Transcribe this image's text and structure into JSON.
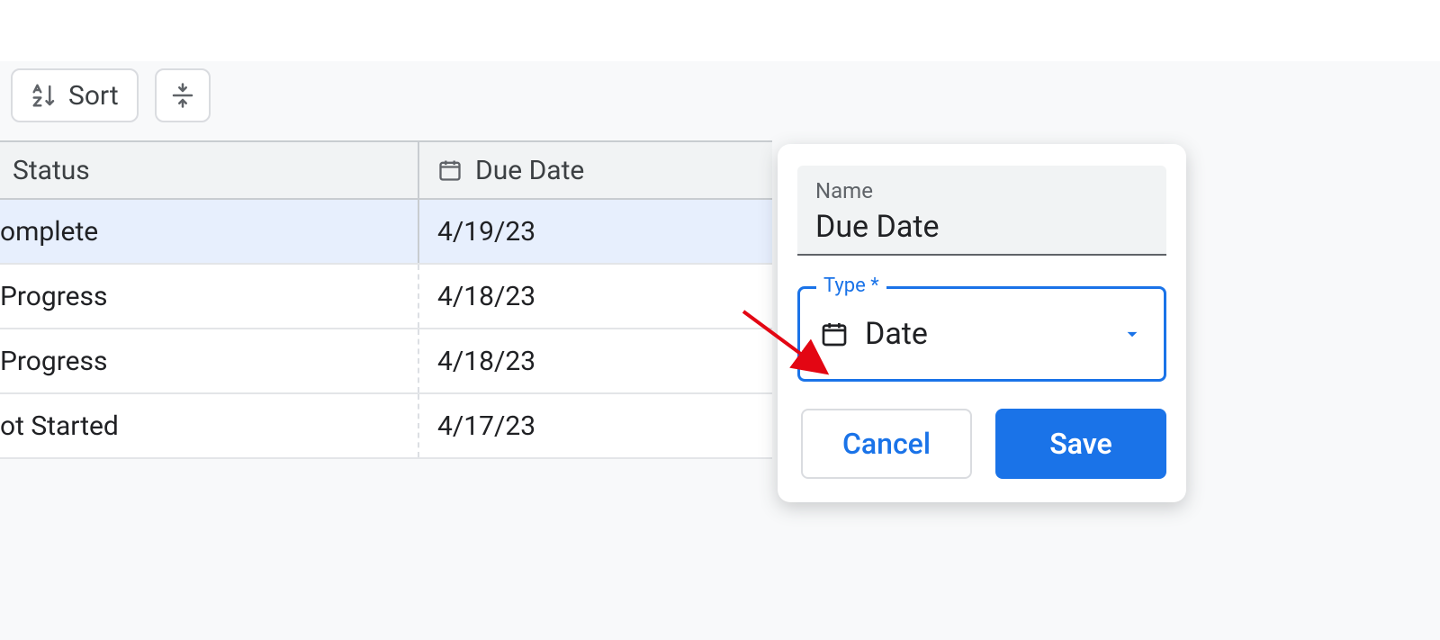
{
  "toolbar": {
    "sort_label": "Sort"
  },
  "table": {
    "columns": {
      "status": "Status",
      "due_date": "Due Date"
    },
    "rows": [
      {
        "status": "omplete",
        "due": "4/19/23",
        "selected": true
      },
      {
        "status": "Progress",
        "due": "4/18/23",
        "selected": false
      },
      {
        "status": "Progress",
        "due": "4/18/23",
        "selected": false
      },
      {
        "status": "ot Started",
        "due": "4/17/23",
        "selected": false
      }
    ]
  },
  "popover": {
    "name_label": "Name",
    "name_value": "Due Date",
    "type_label": "Type *",
    "type_value": "Date",
    "cancel": "Cancel",
    "save": "Save"
  },
  "colors": {
    "primary": "#1a73e8",
    "border": "#dadce0",
    "header_bg": "#f1f3f4",
    "selected_row": "#e7effd",
    "arrow": "#e30613"
  }
}
